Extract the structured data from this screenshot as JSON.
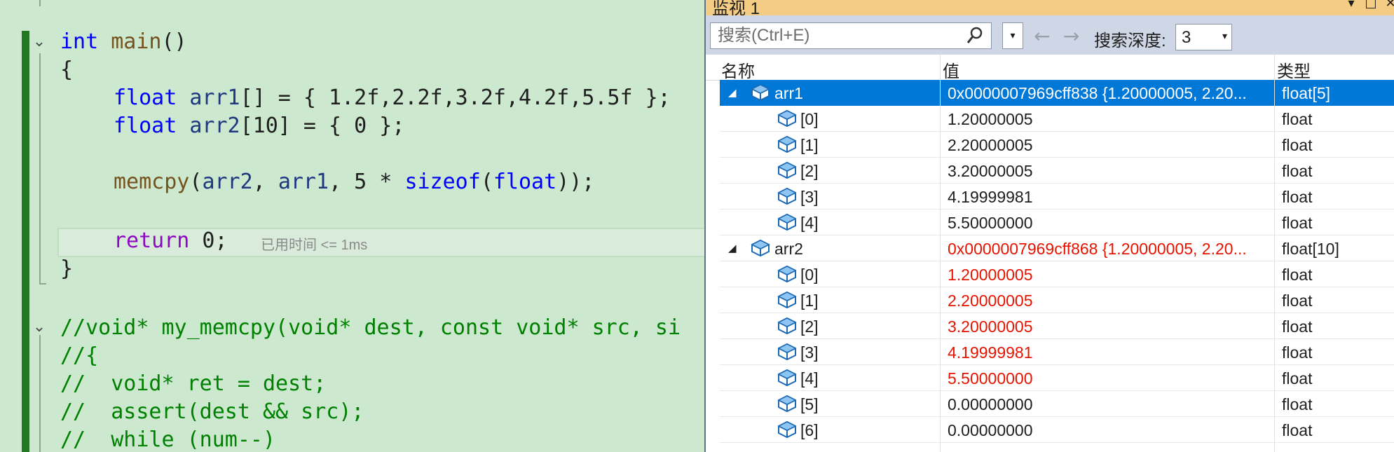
{
  "editor": {
    "fold_glyph": "⌄",
    "lines": {
      "l1": {
        "kw": "int",
        "fn": "main",
        "rest": "()"
      },
      "l2": "{",
      "l3": {
        "kw": "float",
        "id": "arr1",
        "rest": "[] = { 1.2f,2.2f,3.2f,4.2f,5.5f };"
      },
      "l4": {
        "kw": "float",
        "id": "arr2",
        "rest": "[10] = { 0 };"
      },
      "l5": {
        "fn": "memcpy",
        "p1": "(",
        "a": "arr2",
        "c1": ", ",
        "b": "arr1",
        "c2": ", 5 * ",
        "kw": "sizeof",
        "p2": "(",
        "kw2": "float",
        "p3": "));"
      },
      "l6": {
        "kw": "return",
        "rest": " 0;"
      },
      "l7": "}",
      "l8": "//void* my_memcpy(void* dest, const void* src, si",
      "l9": "//{",
      "l10": "//  void* ret = dest;",
      "l11": "//  assert(dest && src);",
      "l12": "//  while (num--)"
    },
    "perf_tip": "已用时间 <= 1ms"
  },
  "watch": {
    "title": "监视 1",
    "pin_glyph": "▾",
    "restore_glyph": "□",
    "close_glyph": "✕",
    "search_placeholder": "搜索(Ctrl+E)",
    "dropdown_glyph": "▾",
    "back_glyph": "←",
    "forward_glyph": "→",
    "depth_label": "搜索深度:",
    "depth_value": "3",
    "columns": {
      "name": "名称",
      "value": "值",
      "type": "类型"
    },
    "expander_glyph": "◢",
    "rows": [
      {
        "name": "arr1",
        "value": "0x0000007969cff838 {1.20000005, 2.20...",
        "type": "float[5]"
      },
      {
        "name": "[0]",
        "value": "1.20000005",
        "type": "float"
      },
      {
        "name": "[1]",
        "value": "2.20000005",
        "type": "float"
      },
      {
        "name": "[2]",
        "value": "3.20000005",
        "type": "float"
      },
      {
        "name": "[3]",
        "value": "4.19999981",
        "type": "float"
      },
      {
        "name": "[4]",
        "value": "5.50000000",
        "type": "float"
      },
      {
        "name": "arr2",
        "value": "0x0000007969cff868 {1.20000005, 2.20...",
        "type": "float[10]"
      },
      {
        "name": "[0]",
        "value": "1.20000005",
        "type": "float"
      },
      {
        "name": "[1]",
        "value": "2.20000005",
        "type": "float"
      },
      {
        "name": "[2]",
        "value": "3.20000005",
        "type": "float"
      },
      {
        "name": "[3]",
        "value": "4.19999981",
        "type": "float"
      },
      {
        "name": "[4]",
        "value": "5.50000000",
        "type": "float"
      },
      {
        "name": "[5]",
        "value": "0.00000000",
        "type": "float"
      },
      {
        "name": "[6]",
        "value": "0.00000000",
        "type": "float"
      }
    ]
  }
}
